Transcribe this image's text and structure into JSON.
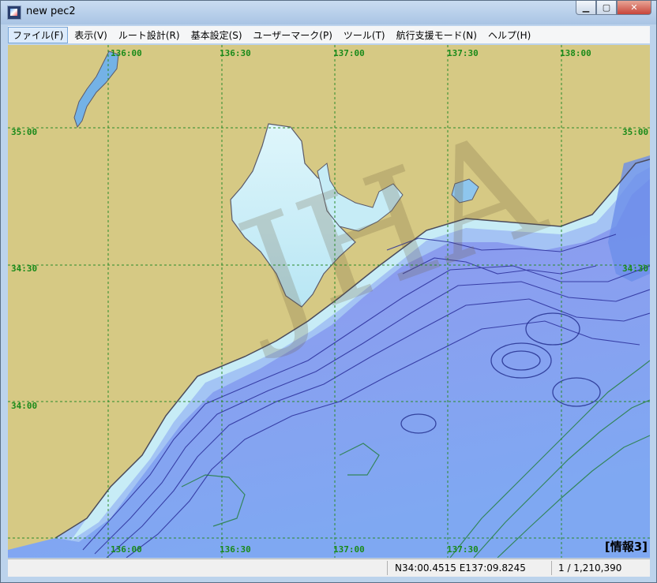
{
  "window": {
    "title": "new pec2",
    "min_glyph": "▁",
    "max_glyph": "▢",
    "close_glyph": "✕"
  },
  "menu": {
    "items": [
      {
        "id": "file",
        "label": "ファイル(F)"
      },
      {
        "id": "view",
        "label": "表示(V)"
      },
      {
        "id": "route",
        "label": "ルート設計(R)"
      },
      {
        "id": "settings",
        "label": "基本設定(S)"
      },
      {
        "id": "usermark",
        "label": "ユーザーマーク(P)"
      },
      {
        "id": "tools",
        "label": "ツール(T)"
      },
      {
        "id": "navmode",
        "label": "航行支援モード(N)"
      },
      {
        "id": "help",
        "label": "ヘルプ(H)"
      }
    ]
  },
  "map": {
    "longitude_labels_top": [
      "136:00",
      "136:30",
      "137:00",
      "137:30",
      "138:00"
    ],
    "longitude_labels_bottom": [
      "136:00",
      "136:30",
      "137:00",
      "137:30"
    ],
    "latitude_labels_left": [
      "35:00",
      "34:30",
      "34:00"
    ],
    "latitude_labels_right": [
      "35:00",
      "34:30"
    ],
    "watermark": "JHA",
    "info_label": "[情報3]",
    "colors": {
      "land": "#d6c984",
      "grid": "#2a8a2a",
      "deep": "#7d95ea",
      "shallow": "#cfeff8"
    }
  },
  "status": {
    "coordinate": "N34:00.4515 E137:09.8245",
    "scale": "1 / 1,210,390"
  }
}
